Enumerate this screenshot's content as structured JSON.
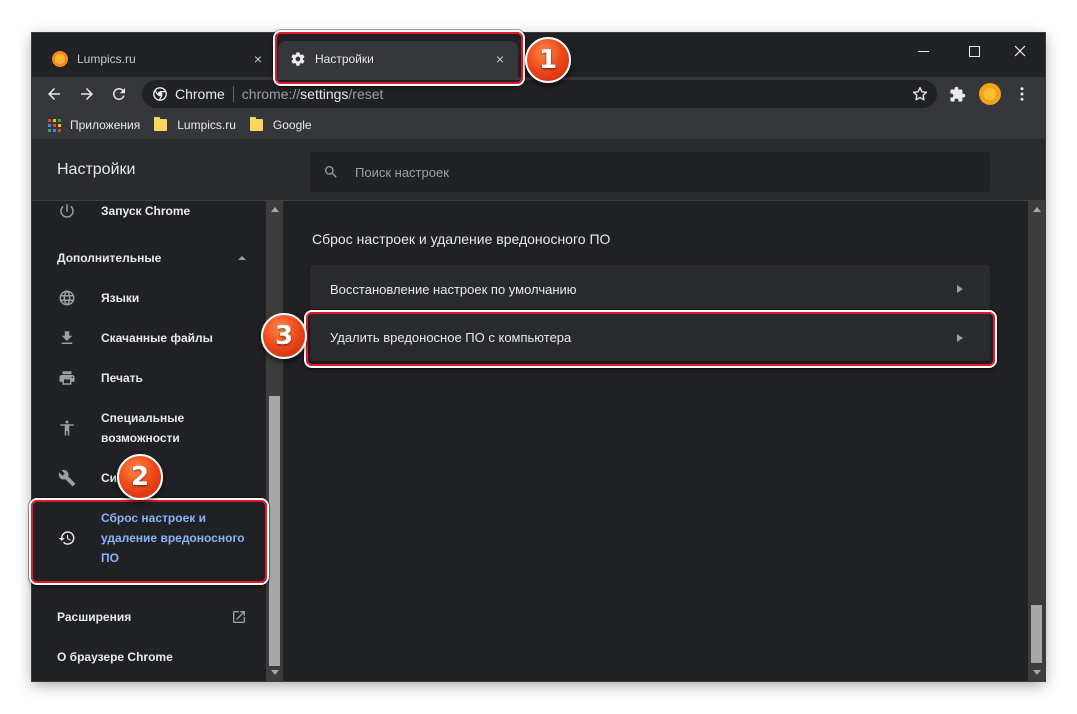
{
  "tabs": [
    {
      "title": "Lumpics.ru",
      "close": "×"
    },
    {
      "title": "Настройки",
      "close": "×"
    }
  ],
  "omnibox": {
    "chip": "Chrome",
    "url_scheme": "chrome://",
    "url_host": "settings",
    "url_path": "/reset"
  },
  "bookmarks": [
    "Приложения",
    "Lumpics.ru",
    "Google"
  ],
  "settings": {
    "title": "Настройки",
    "search_placeholder": "Поиск настроек"
  },
  "sidebar": {
    "startup": "Запуск Chrome",
    "advanced": "Дополнительные",
    "items": [
      {
        "label": "Языки",
        "icon": "globe-icon"
      },
      {
        "label": "Скачанные файлы",
        "icon": "download-icon"
      },
      {
        "label": "Печать",
        "icon": "printer-icon"
      },
      {
        "label": "Специальные возможности",
        "icon": "accessibility-icon"
      },
      {
        "label": "Си",
        "icon": "wrench-icon"
      },
      {
        "label": "Сброс настроек и удаление вредоносного ПО",
        "icon": "restore-icon"
      }
    ],
    "extensions": "Расширения",
    "about": "О браузере Chrome"
  },
  "main": {
    "section_title": "Сброс настроек и удаление вредоносного ПО",
    "rows": [
      {
        "label": "Восстановление настроек по умолчанию"
      },
      {
        "label": "Удалить вредоносное ПО с компьютера"
      }
    ]
  },
  "annotations": [
    "1",
    "2",
    "3"
  ],
  "colors": {
    "accent_blue": "#8ab4f8",
    "highlight_red": "#e3192b",
    "badge_orange": "#ef4b1c"
  }
}
